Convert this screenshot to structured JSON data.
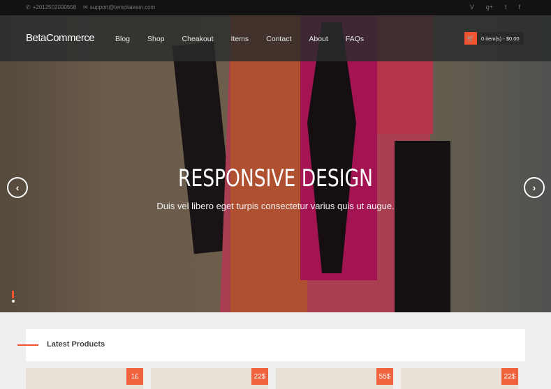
{
  "topbar": {
    "phone": "+2012502000558",
    "email": "support@templatesm.com",
    "social": [
      "vine-icon",
      "google-plus-icon",
      "twitter-icon",
      "facebook-icon"
    ]
  },
  "nav": {
    "logo": "BetaCommerce",
    "menu": [
      "Blog",
      "Shop",
      "Cheakout",
      "Items",
      "Contact",
      "About",
      "FAQs"
    ],
    "cart": "0 item(s) - $0.00"
  },
  "hero": {
    "title": "RESPONSIVE DESIGN",
    "subtitle": "Duis vel libero eget turpis consectetur varius quis ut augue."
  },
  "section": {
    "title": "Latest Products"
  },
  "products": [
    {
      "price": "1£"
    },
    {
      "price": "22$"
    },
    {
      "price": "55$"
    },
    {
      "price": "22$"
    }
  ],
  "colors": {
    "accent": "#f0532d"
  }
}
